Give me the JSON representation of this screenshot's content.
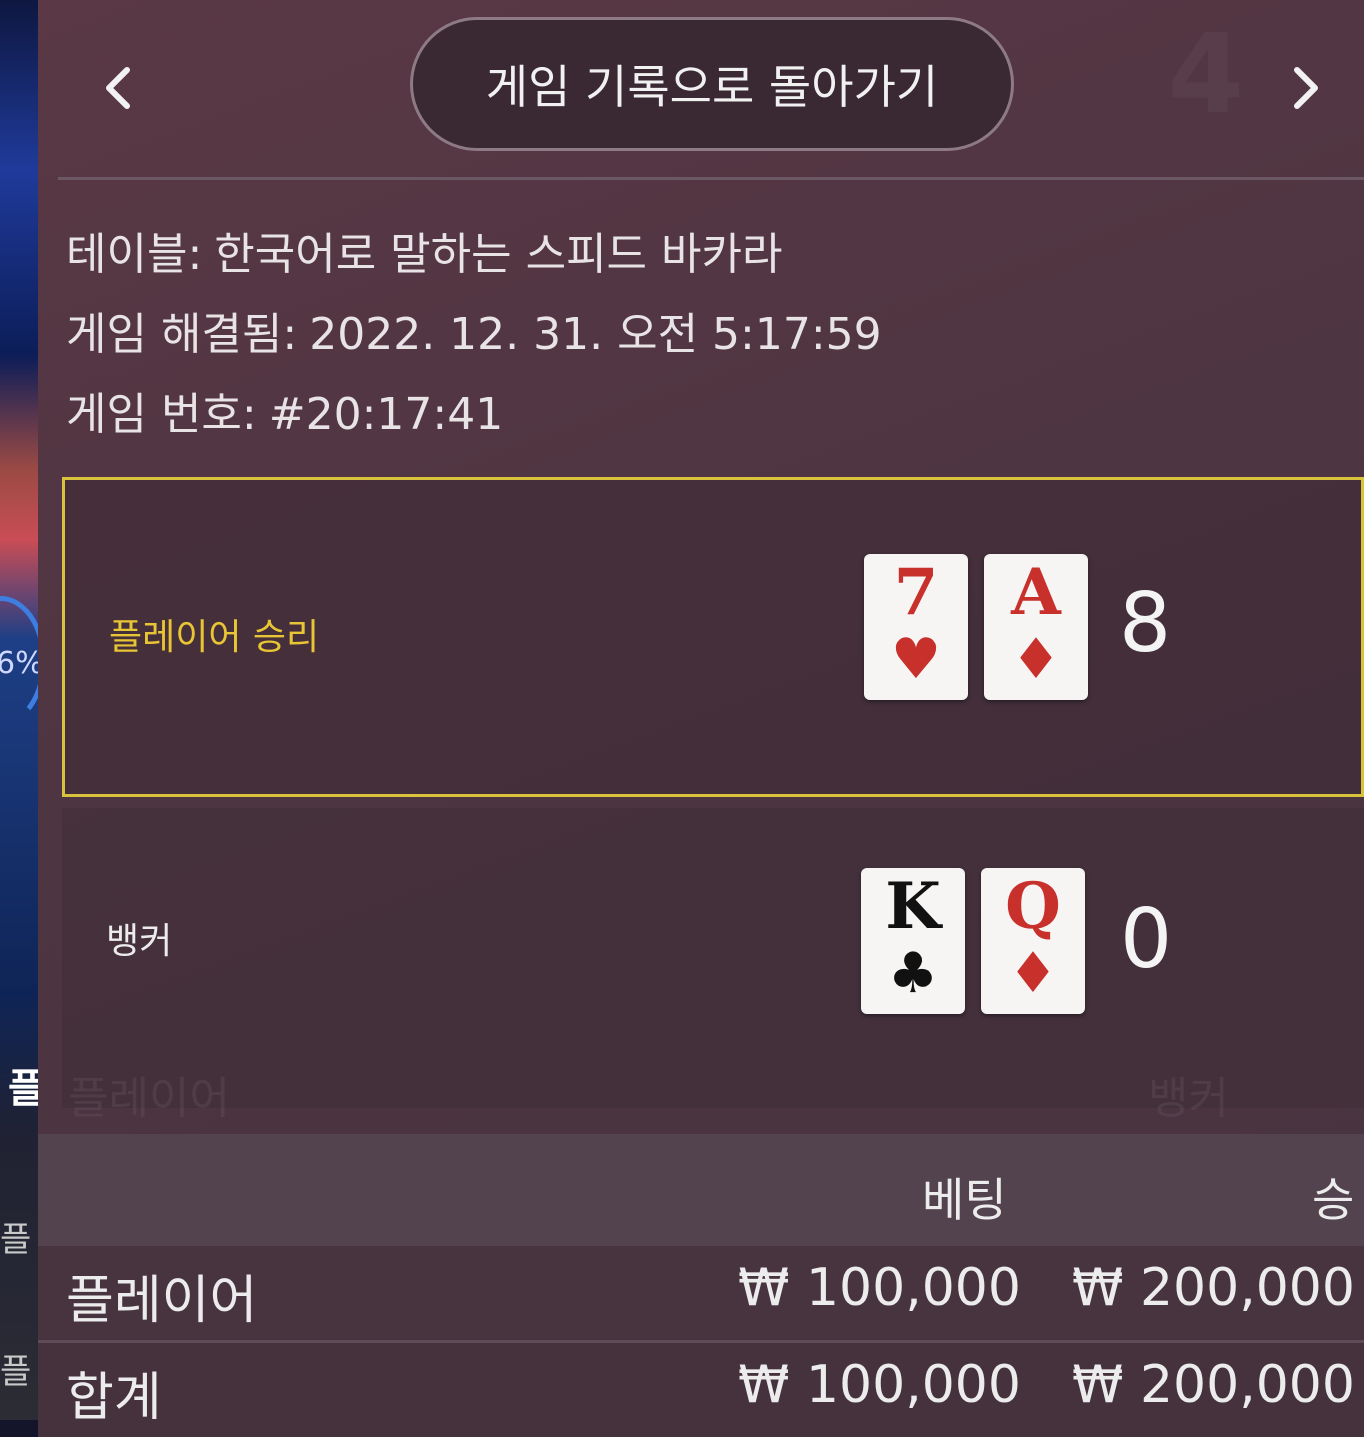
{
  "background_strip": {
    "percent_fragment": "6%",
    "glyph_1": "플",
    "glyph_2": "플",
    "glyph_3": "플"
  },
  "header": {
    "back_button_label": "게임 기록으로 돌아가기",
    "prev_icon": "chevron-left-icon",
    "next_icon": "chevron-right-icon",
    "ghost_number": "4"
  },
  "info": {
    "table_label": "테이블:",
    "table_value": "한국어로 말하는 스피드 바카라",
    "resolved_label": "게임 해결됨:",
    "resolved_value": "2022. 12. 31. 오전 5:17:59",
    "number_label": "게임 번호:",
    "number_value": "#20:17:41"
  },
  "hands": {
    "player": {
      "label": "플레이어 승리",
      "cards": [
        {
          "rank": "7",
          "suit": "♥",
          "color": "red"
        },
        {
          "rank": "A",
          "suit": "♦",
          "color": "red"
        }
      ],
      "score": "8",
      "highlight_color": "#d9c23c"
    },
    "banker": {
      "label": "뱅커",
      "cards": [
        {
          "rank": "K",
          "suit": "♣",
          "color": "black"
        },
        {
          "rank": "Q",
          "suit": "♦",
          "color": "red"
        }
      ],
      "score": "0"
    }
  },
  "ghost_row": {
    "left": "플레이어",
    "right": "뱅커"
  },
  "bets_table": {
    "headers": {
      "bet": "베팅",
      "win": "승"
    },
    "rows": [
      {
        "name": "플레이어",
        "bet": "₩ 100,000",
        "win": "₩ 200,000"
      },
      {
        "name": "합계",
        "bet": "₩ 100,000",
        "win": "₩ 200,000"
      }
    ]
  }
}
